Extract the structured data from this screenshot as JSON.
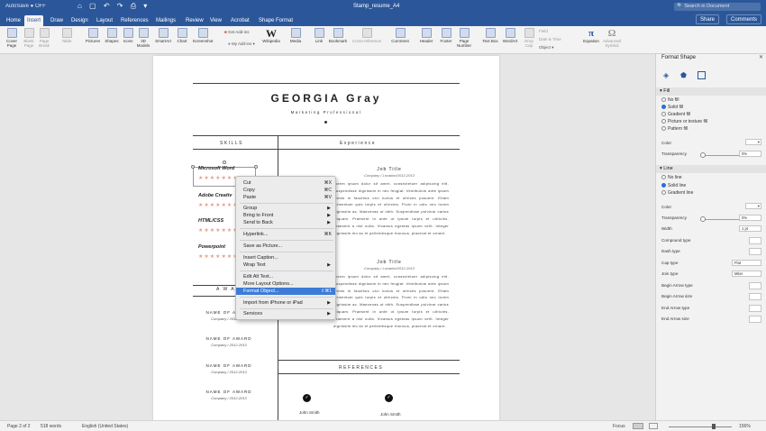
{
  "titlebar": {
    "autosave": "AutoSave ● OFF",
    "qat": "⌂ ▢ ↶ ↷ ⎙ ▾",
    "doc_title": "Stamp_resume_A4",
    "search_placeholder": "🔍 Search in Document"
  },
  "tabs": [
    "Home",
    "Insert",
    "Draw",
    "Design",
    "Layout",
    "References",
    "Mailings",
    "Review",
    "View",
    "Acrobat",
    "Shape Format"
  ],
  "share_label": "Share",
  "comments_label": "Comments",
  "ribbon": {
    "buttons": [
      {
        "label": "Cover\nPage"
      },
      {
        "label": "Blank\nPage"
      },
      {
        "label": "Page\nBreak"
      },
      {
        "label": "Table"
      },
      {
        "label": "Pictures"
      },
      {
        "label": "Shapes"
      },
      {
        "label": "Icons"
      },
      {
        "label": "3D\nModels"
      },
      {
        "label": "SmartArt"
      },
      {
        "label": "Chart"
      },
      {
        "label": "Screenshot"
      },
      {
        "label": "Wikipedia"
      },
      {
        "label": "Media"
      },
      {
        "label": "Link"
      },
      {
        "label": "Bookmark"
      },
      {
        "label": "Cross-reference"
      },
      {
        "label": "Comment"
      },
      {
        "label": "Header"
      },
      {
        "label": "Footer"
      },
      {
        "label": "Page\nNumber"
      },
      {
        "label": "Text Box"
      },
      {
        "label": "WordArt"
      },
      {
        "label": "Drop\nCap"
      },
      {
        "label": "Equation"
      },
      {
        "label": "Advanced\nSymbol"
      }
    ],
    "get_addins": "Get Add-ins",
    "my_addins": "My Add-ins",
    "field": "Field",
    "date_time": "Date & Time",
    "object": "Object"
  },
  "document": {
    "name": "GEORGIA Gray",
    "subtitle": "Marketing Professional",
    "skills_header": "SKILLS",
    "experience_header": "Experience",
    "skills": [
      "Microsoft Word",
      "Adobe Creativ",
      "HTML/CSS",
      "Powerpoint"
    ],
    "stars": "★★★★★★★",
    "awards_header": "A W A",
    "awards": [
      {
        "title": "NAME OF AWARD",
        "detail": "Company / 2012-2013"
      },
      {
        "title": "NAME OF AWARD",
        "detail": "Company / 2012-2013"
      },
      {
        "title": "NAME OF AWARD",
        "detail": "Company / 2012-2013"
      },
      {
        "title": "NAME OF AWARD",
        "detail": "Company / 2012-2013"
      }
    ],
    "jobs": [
      {
        "title": "Job Title",
        "detail": "Company / Location/2012-2013"
      },
      {
        "title": "Job Title",
        "detail": "Company / Location/2012-2013"
      }
    ],
    "paragraph": "Lorem ipsum dolor sit amet, consectetuer adipiscing elit. Suspendisse dignissim in nec feugiat. Vestibulum ante ipsum primis in faucibus orci luctus et ultrices posuere. Etiam fermentum quis turpis et ultricies. Proin in odio nec lorem dignissim ac. Maecenas ut nibh. Suspendisse pulvinar varius aliquam. Praesent in ante ut ipsum turpis et ultricies. Praesent a nisl nulla. Vivamus egestas ipsum velit. Integer dignissim leo ac et pellentesque rhoncus, placerat et ornare.",
    "references_header": "REFERENCES",
    "references": [
      "John Smith",
      "John Smith"
    ]
  },
  "context_menu": [
    {
      "label": "Cut",
      "shortcut": "⌘X"
    },
    {
      "label": "Copy",
      "shortcut": "⌘C"
    },
    {
      "label": "Paste",
      "shortcut": "⌘V"
    },
    {
      "label": "Group",
      "arrow": "▶"
    },
    {
      "label": "Bring to Front",
      "arrow": "▶"
    },
    {
      "label": "Send to Back",
      "arrow": "▶"
    },
    {
      "label": "Hyperlink...",
      "shortcut": "⌘K"
    },
    {
      "label": "Save as Picture..."
    },
    {
      "label": "Insert Caption..."
    },
    {
      "label": "Wrap Text",
      "arrow": "▶"
    },
    {
      "label": "Edit Alt Text..."
    },
    {
      "label": "More Layout Options..."
    },
    {
      "label": "Format Object...",
      "shortcut": "⇧⌘1"
    },
    {
      "label": "Import from iPhone or iPad",
      "arrow": "▶"
    },
    {
      "label": "Services",
      "arrow": "▶"
    }
  ],
  "format_pane": {
    "title": "Format Shape",
    "close": "✕",
    "fill_header": "Fill",
    "fill_options": [
      "No fill",
      "Solid fill",
      "Gradient fill",
      "Picture or texture fill",
      "Pattern fill"
    ],
    "fill_color_label": "Color",
    "fill_transparency_label": "Transparency",
    "fill_transparency_value": "0%",
    "line_header": "Line",
    "line_options": [
      "No line",
      "Solid line",
      "Gradient line"
    ],
    "line_color_label": "Color",
    "line_transparency_label": "Transparency",
    "line_transparency_value": "0%",
    "width_label": "Width",
    "width_value": "1 pt",
    "compound_label": "Compound type",
    "dash_label": "Dash type",
    "cap_label": "Cap type",
    "cap_value": "Flat",
    "join_label": "Join type",
    "join_value": "Miter",
    "begin_arrow_type": "Begin Arrow type",
    "begin_arrow_size": "Begin Arrow size",
    "end_arrow_type": "End Arrow type",
    "end_arrow_size": "End Arrow size"
  },
  "statusbar": {
    "page": "Page 2 of 2",
    "words": "518 words",
    "language": "English (United States)",
    "focus": "Focus",
    "zoom": "156%"
  }
}
